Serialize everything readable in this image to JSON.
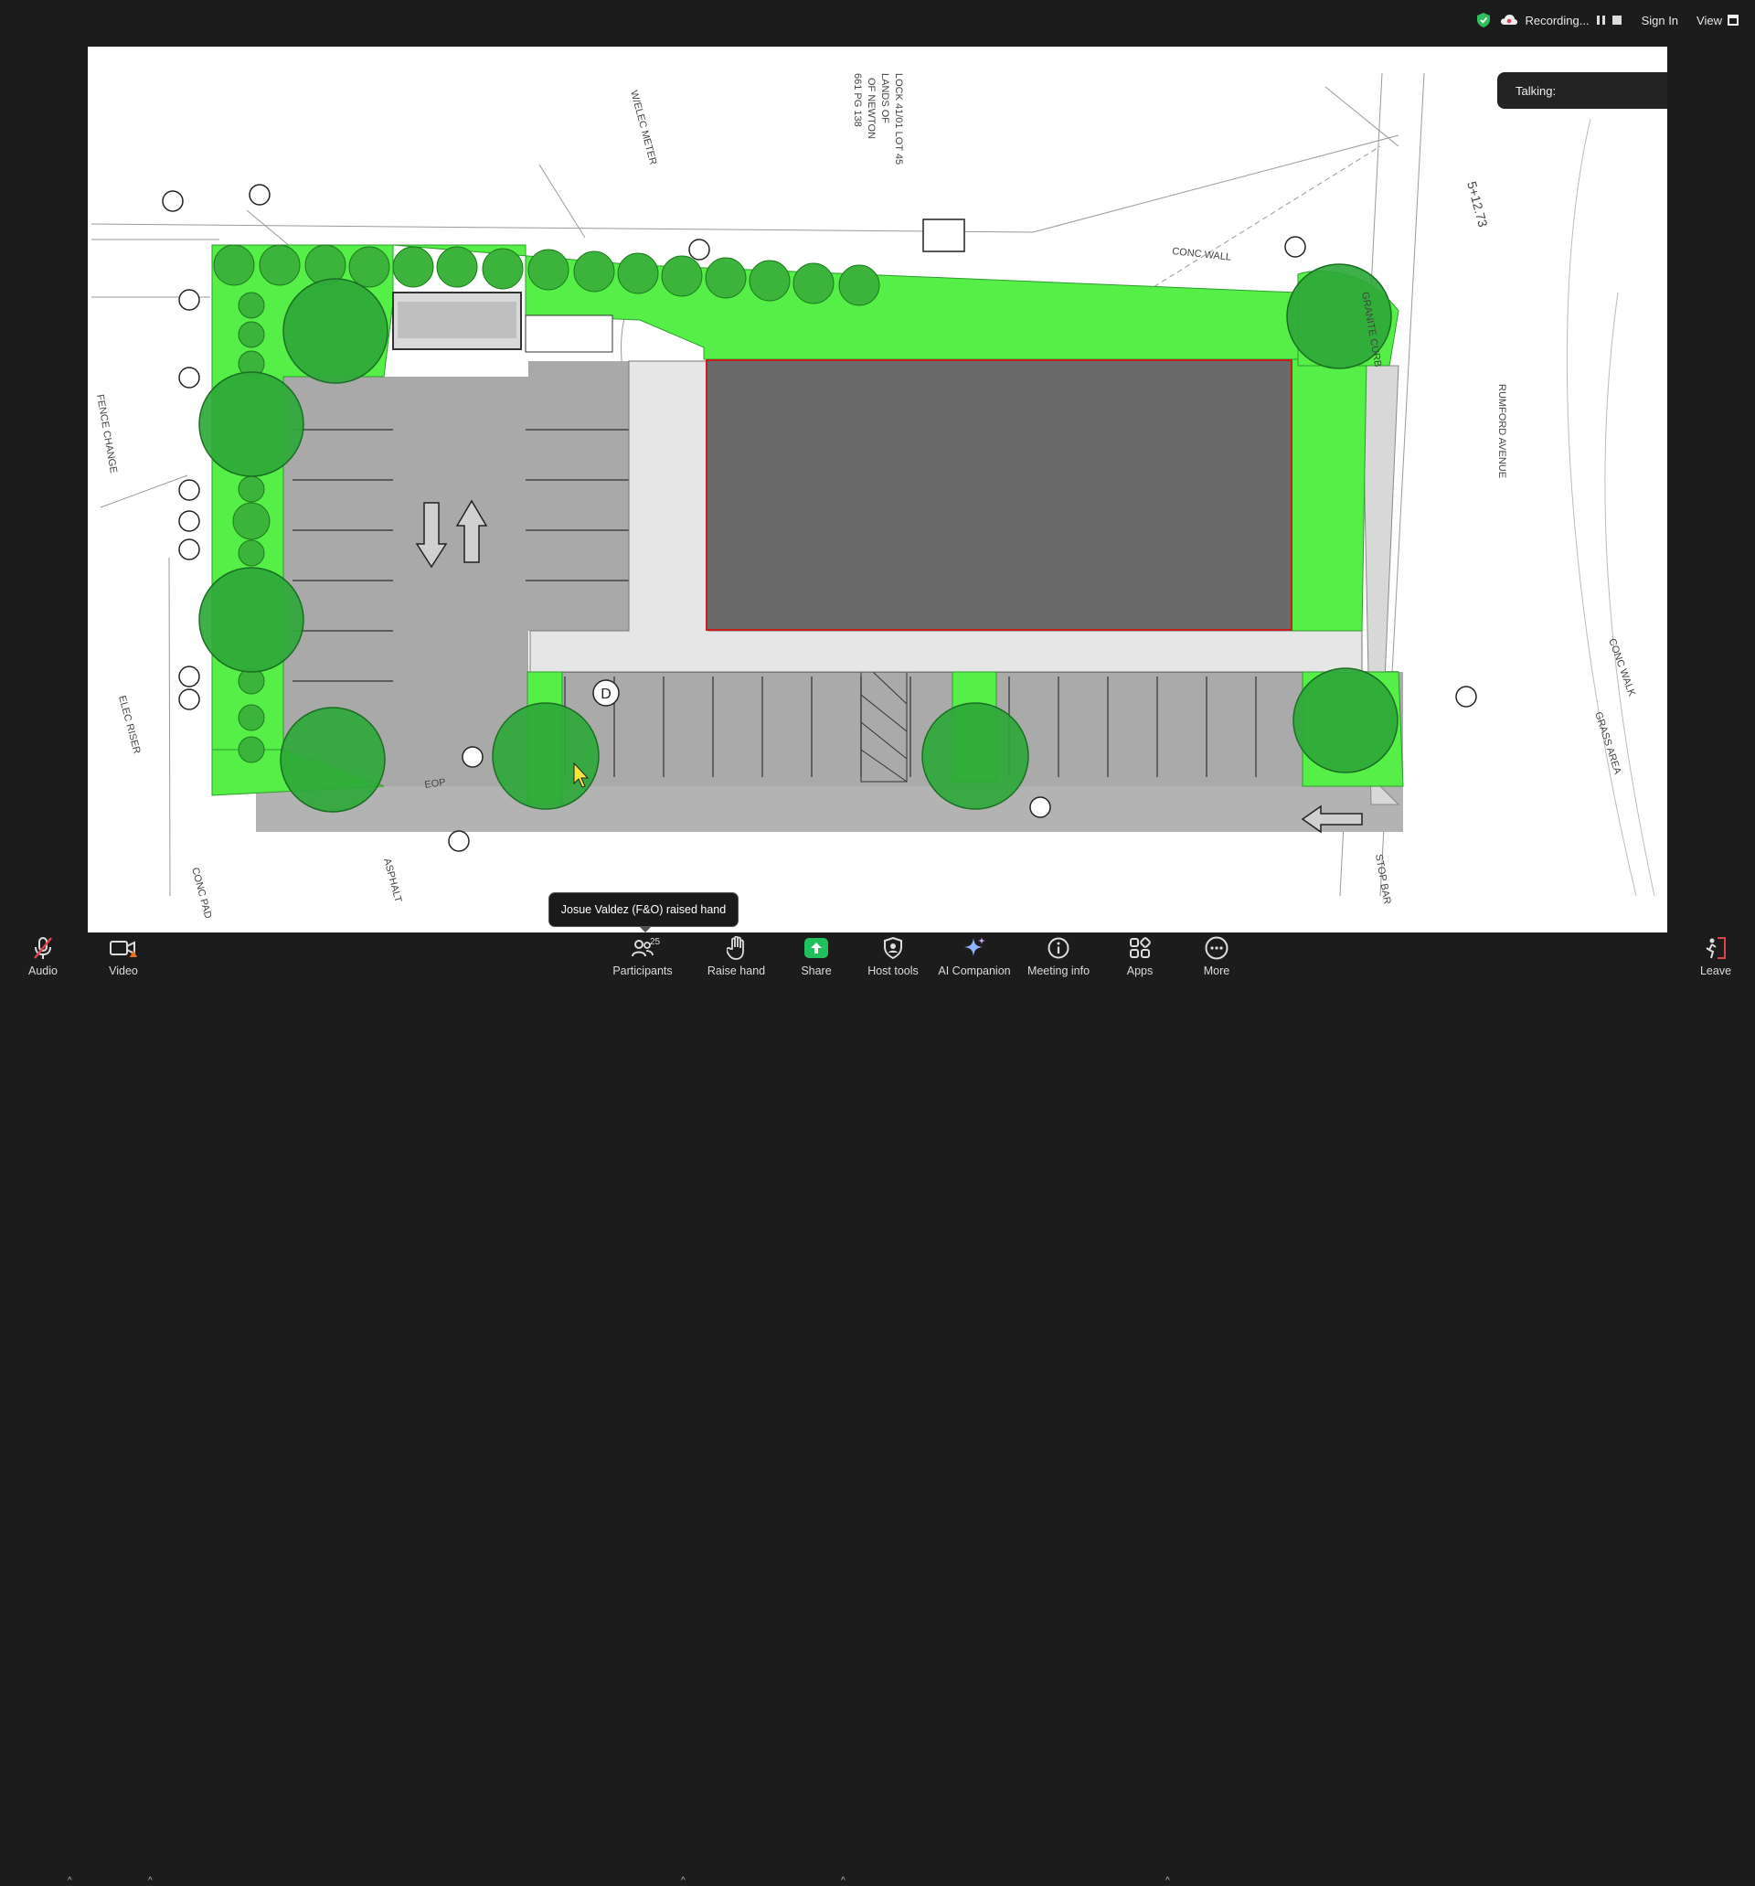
{
  "top_bar": {
    "recording_label": "Recording...",
    "sign_in_label": "Sign In",
    "view_label": "View"
  },
  "talking": {
    "label": "Talking:"
  },
  "toast": {
    "text": "Josue Valdez (F&O) raised hand"
  },
  "drawing": {
    "labels": {
      "lock": "LOCK 41/01 LOT 45",
      "lands": "LANDS OF",
      "of_newton": "OF NEWTON",
      "book": "661 PG 138",
      "elec_meter": "W/ELEC METER",
      "conc_wall": "CONC WALL",
      "street": "RUMFORD AVENUE",
      "station": "5+12.73",
      "granite_curb": "GRANITE CURB",
      "conc_walk": "CONC WALK",
      "grass_area": "GRASS AREA",
      "fence_change": "FENCE CHANGE",
      "elec_riser": "ELEC RISER",
      "conc_pad": "CONC PAD",
      "asphalt": "ASPHALT",
      "stop_bar": "STOP BAR",
      "eop": "EOP",
      "accessible_d": "D"
    }
  },
  "toolbar": {
    "audio": "Audio",
    "video": "Video",
    "participants": "Participants",
    "participants_count": "25",
    "raise_hand": "Raise hand",
    "share": "Share",
    "host_tools": "Host tools",
    "ai_companion": "AI Companion",
    "meeting_info": "Meeting info",
    "apps": "Apps",
    "more": "More",
    "leave": "Leave"
  },
  "colors": {
    "landscape_green": "#55ef48",
    "tree_green": "#2fa83a",
    "building_gray": "#6a6a6a",
    "pavement_gray": "#a9a9a9",
    "share_green": "#20c05c",
    "leave_red": "#e0424b"
  }
}
